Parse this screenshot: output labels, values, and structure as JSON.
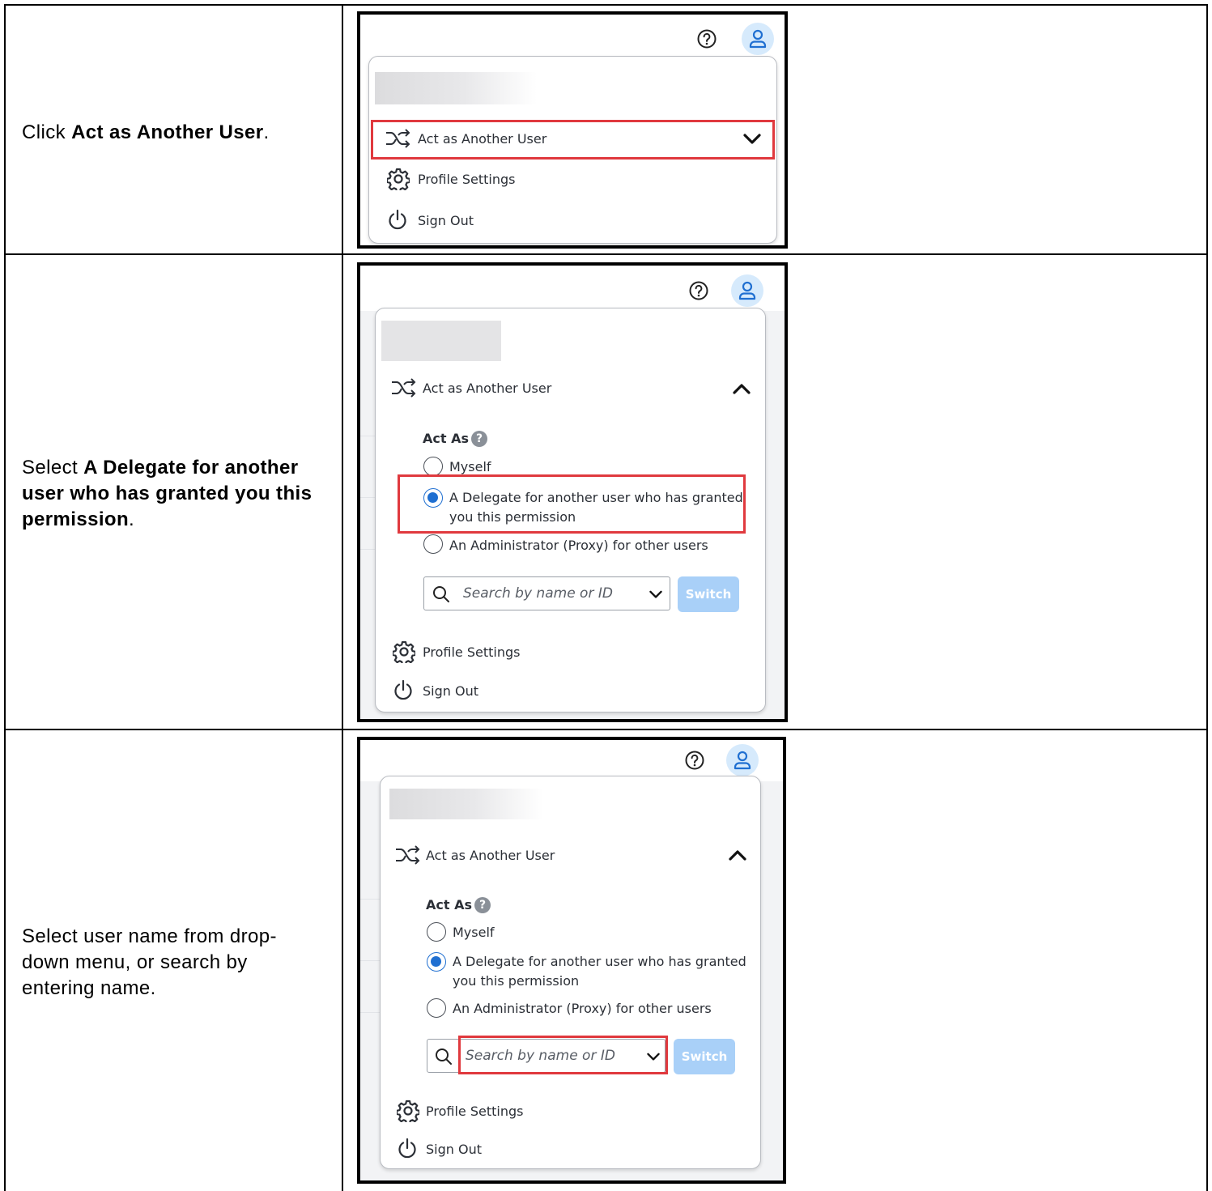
{
  "rows": [
    {
      "instruction_prefix": "Click ",
      "instruction_bold": "Act as Another User",
      "instruction_suffix": ".",
      "menu": {
        "act_as_label": "Act as Another User",
        "profile_settings": "Profile Settings",
        "sign_out": "Sign Out"
      }
    },
    {
      "instruction_prefix": "Select ",
      "instruction_bold": "A Delegate for another user who has granted you this permission",
      "instruction_suffix": ".",
      "menu": {
        "act_as_label": "Act as Another User",
        "act_as_heading": "Act As",
        "option_myself": "Myself",
        "option_delegate_line1": "A Delegate for another user who has granted",
        "option_delegate_line2": "you this permission",
        "option_admin": "An Administrator (Proxy) for other users",
        "search_placeholder": "Search by name or ID",
        "switch_label": "Switch",
        "profile_settings": "Profile Settings",
        "sign_out": "Sign Out"
      }
    },
    {
      "instruction_text": "Select user name from drop-down menu, or search by entering name.",
      "menu": {
        "act_as_label": "Act as Another User",
        "act_as_heading": "Act As",
        "option_myself": "Myself",
        "option_delegate_line1": "A Delegate for another user who has granted",
        "option_delegate_line2": "you this permission",
        "option_admin": "An Administrator (Proxy) for other users",
        "search_placeholder": "Search by name or ID",
        "switch_label": "Switch",
        "profile_settings": "Profile Settings",
        "sign_out": "Sign Out"
      }
    }
  ],
  "icons": [
    "help-circle-icon",
    "user-icon",
    "shuffle-icon",
    "chevron-down-icon",
    "chevron-up-icon",
    "gear-icon",
    "power-icon",
    "search-icon",
    "question-icon"
  ],
  "colors": {
    "highlight": "#e0393e",
    "accent": "#1f6fd1",
    "switch_disabled": "#a9d0f8",
    "avatar_bg": "#d6eafc"
  }
}
